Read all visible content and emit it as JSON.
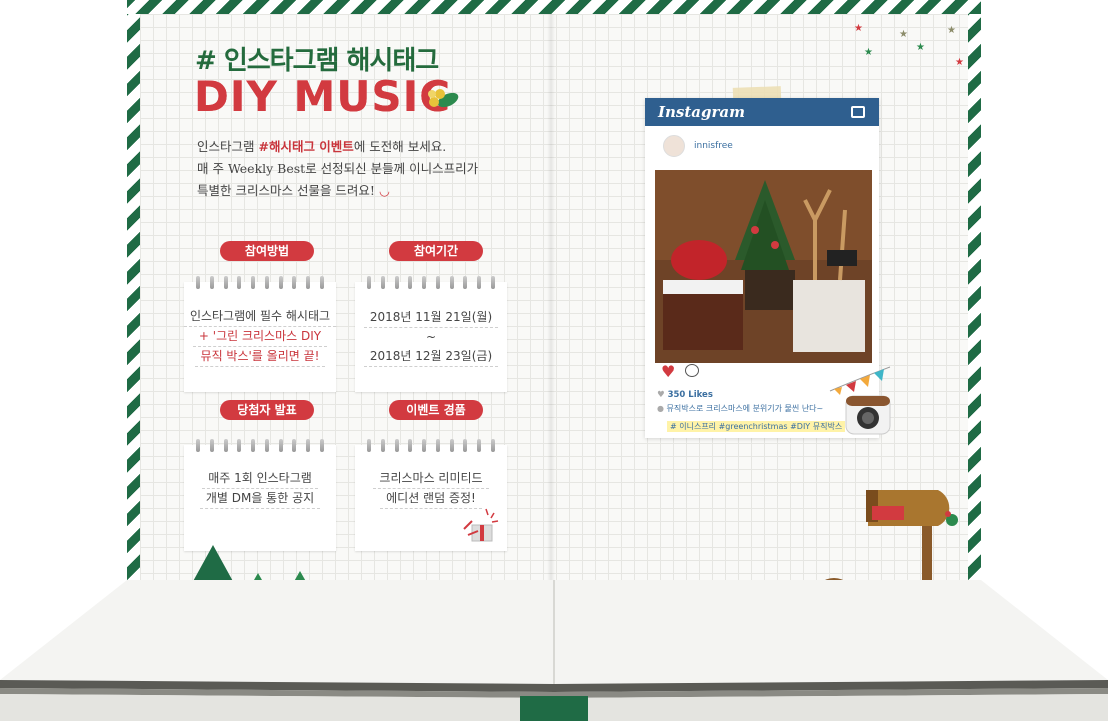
{
  "header": {
    "title_kr": "# 인스타그램 해시태그",
    "title_en": "DIY MUSIC"
  },
  "intro": {
    "line1_a": "인스타그램 ",
    "line1_hl": "#해시태그 이벤트",
    "line1_b": "에 도전해 보세요.",
    "line2": "매 주 Weekly Best로 선정되신 분들께 이니스프리가",
    "line3": "특별한 크리스마스 선물을 드려요!"
  },
  "sections": {
    "how": {
      "tag": "참여방법",
      "line1": "인스타그램에 필수 해시태그",
      "line2": "+ '그린 크리스마스 DIY",
      "line3": "뮤직 박스'를 올리면 끝!"
    },
    "period": {
      "tag": "참여기간",
      "line1": "2018년 11월 21일(월)",
      "line2": "~",
      "line3": "2018년 12월 23일(금)"
    },
    "winner": {
      "tag": "당첨자 발표",
      "line1": "매주 1회 인스타그램",
      "line2": "개별 DM을 통한 공지"
    },
    "prize": {
      "tag": "이벤트 경품",
      "line1": "크리스마스 리미티드",
      "line2": "에디션 랜덤 증정!"
    }
  },
  "instagram": {
    "brand": "Instagram",
    "username": "innisfree",
    "likes": "350 Likes",
    "caption": "뮤직박스로 크리스마스에 분위기가 물씬 난다~",
    "hashtags": "# 이니스프리 #greenchristmas #DIY 뮤직박스"
  },
  "colors": {
    "accent_red": "#d23a40",
    "title_green": "#246b3d",
    "insta_blue": "#2f5f8f",
    "stripe_green": "#1f6b45"
  }
}
